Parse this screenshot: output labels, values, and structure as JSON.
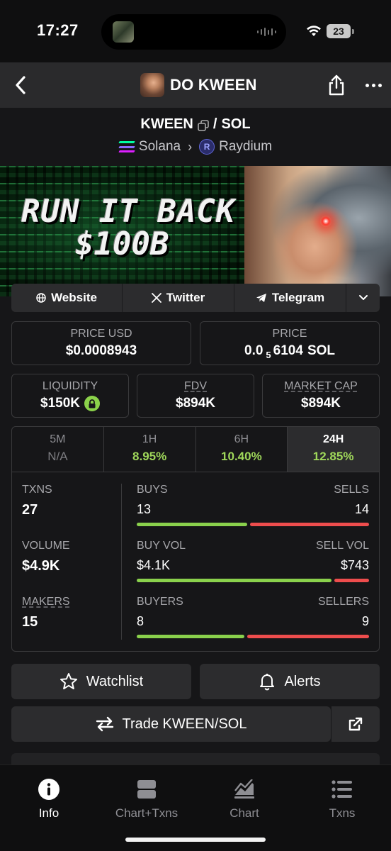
{
  "status_bar": {
    "time": "17:27",
    "battery": "23"
  },
  "nav": {
    "title": "DO KWEEN"
  },
  "pair": {
    "base": "KWEEN",
    "separator": "/",
    "quote": "SOL"
  },
  "chain": {
    "network": "Solana",
    "dex": "Raydium"
  },
  "banner": {
    "line1": "RUN IT BACK",
    "line2": "$100B"
  },
  "links": [
    {
      "label": "Website",
      "icon": "globe-icon"
    },
    {
      "label": "Twitter",
      "icon": "x-logo-icon"
    },
    {
      "label": "Telegram",
      "icon": "telegram-icon"
    }
  ],
  "price_usd": {
    "label": "PRICE USD",
    "value": "$0.0008943"
  },
  "price_native": {
    "label": "PRICE",
    "prefix": "0.0",
    "zeros": "5",
    "digits": "6104",
    "unit": "SOL"
  },
  "liquidity": {
    "label": "LIQUIDITY",
    "value": "$150K"
  },
  "fdv": {
    "label": "FDV",
    "value": "$894K"
  },
  "market_cap": {
    "label": "MARKET CAP",
    "value": "$894K"
  },
  "timeframes": [
    {
      "label": "5M",
      "value": "N/A"
    },
    {
      "label": "1H",
      "value": "8.95%"
    },
    {
      "label": "6H",
      "value": "10.40%"
    },
    {
      "label": "24H",
      "value": "12.85%"
    }
  ],
  "active_timeframe": "24H",
  "txns": {
    "label": "TXNS",
    "value": "27"
  },
  "volume": {
    "label": "VOLUME",
    "value": "$4.9K"
  },
  "makers": {
    "label": "MAKERS",
    "value": "15"
  },
  "buys": {
    "label": "BUYS",
    "value": "13",
    "share": 0.48
  },
  "sells": {
    "label": "SELLS",
    "value": "14",
    "share": 0.52
  },
  "buy_vol": {
    "label": "BUY VOL",
    "value": "$4.1K",
    "share": 0.85
  },
  "sell_vol": {
    "label": "SELL VOL",
    "value": "$743",
    "share": 0.15
  },
  "buyers": {
    "label": "BUYERS",
    "value": "8",
    "share": 0.47
  },
  "sellers": {
    "label": "SELLERS",
    "value": "9",
    "share": 0.53
  },
  "actions": {
    "watchlist": "Watchlist",
    "alerts": "Alerts",
    "trade": "Trade KWEEN/SOL"
  },
  "tabbar": [
    {
      "label": "Info",
      "icon": "info-icon"
    },
    {
      "label": "Chart+Txns",
      "icon": "split-view-icon"
    },
    {
      "label": "Chart",
      "icon": "area-chart-icon"
    },
    {
      "label": "Txns",
      "icon": "list-icon"
    }
  ],
  "colors": {
    "positive": "#8ad14c",
    "negative": "#ee4d4d",
    "accent_tab_bg": "#2c2c2e"
  }
}
